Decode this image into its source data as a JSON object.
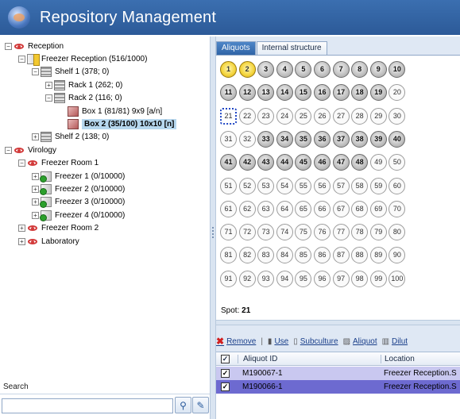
{
  "window": {
    "title": "Repository Management"
  },
  "tree": [
    {
      "label": "Reception",
      "level": 0,
      "icon": "eye-icon",
      "expander": "−"
    },
    {
      "label": "Freezer Reception (516/1000)",
      "level": 1,
      "icon": "freezer-yellow-icon",
      "expander": "−"
    },
    {
      "label": "Shelf 1 (378; 0)",
      "level": 2,
      "icon": "shelf-icon",
      "expander": "−"
    },
    {
      "label": "Rack 1 (262; 0)",
      "level": 3,
      "icon": "rack-icon",
      "expander": "+"
    },
    {
      "label": "Rack 2 (116; 0)",
      "level": 3,
      "icon": "rack-icon",
      "expander": "−"
    },
    {
      "label": "Box 1 (81/81) 9x9 [a/n]",
      "level": 4,
      "icon": "box-icon",
      "expander": ""
    },
    {
      "label": "Box 2 (35/100) 10x10 [n]",
      "level": 4,
      "icon": "box-icon",
      "expander": "",
      "selected": true
    },
    {
      "label": "Shelf 2 (138; 0)",
      "level": 2,
      "icon": "shelf-icon",
      "expander": "+"
    },
    {
      "label": "Virology",
      "level": 0,
      "icon": "eye-icon",
      "expander": "−"
    },
    {
      "label": "Freezer Room 1",
      "level": 1,
      "icon": "eye-icon",
      "expander": "−"
    },
    {
      "label": "Freezer 1 (0/10000)",
      "level": 2,
      "icon": "freezer-green-icon",
      "expander": "+"
    },
    {
      "label": "Freezer 2 (0/10000)",
      "level": 2,
      "icon": "freezer-green-icon",
      "expander": "+"
    },
    {
      "label": "Freezer 3 (0/10000)",
      "level": 2,
      "icon": "freezer-green-icon",
      "expander": "+"
    },
    {
      "label": "Freezer 4 (0/10000)",
      "level": 2,
      "icon": "freezer-green-icon",
      "expander": "+"
    },
    {
      "label": "Freezer Room 2",
      "level": 1,
      "icon": "eye-icon",
      "expander": "+"
    },
    {
      "label": "Laboratory",
      "level": 1,
      "icon": "eye-icon",
      "expander": "+"
    }
  ],
  "search": {
    "label": "Search",
    "value": ""
  },
  "tabs": [
    {
      "label": "Aliquots",
      "active": true
    },
    {
      "label": "Internal structure",
      "active": false
    }
  ],
  "grid": {
    "rows": 10,
    "cols": 10,
    "star_wells": [
      1,
      2
    ],
    "filled_wells": [
      3,
      4,
      5,
      6,
      7,
      8,
      9,
      10,
      11,
      12,
      13,
      14,
      15,
      16,
      17,
      18,
      19,
      33,
      34,
      35,
      36,
      37,
      38,
      39,
      40,
      41,
      42,
      43,
      44,
      45,
      46,
      47,
      48
    ],
    "current_well": 21
  },
  "spot": {
    "label": "Spot:",
    "value": "21"
  },
  "toolbar": [
    {
      "label": "Remove",
      "icon": "remove-x-icon",
      "name": "remove-button"
    },
    {
      "label": "Use",
      "icon": "use-icon",
      "name": "use-button"
    },
    {
      "label": "Subculture",
      "icon": "subculture-icon",
      "name": "subculture-button"
    },
    {
      "label": "Aliquot",
      "icon": "aliquot-icon",
      "name": "aliquot-button"
    },
    {
      "label": "Dilut",
      "icon": "dilution-icon",
      "name": "dilution-button"
    }
  ],
  "table": {
    "columns": [
      "Aliquot ID",
      "Location"
    ],
    "rows": [
      {
        "checked": true,
        "aliquot_id": "M190067-1",
        "location": "Freezer Reception.S"
      },
      {
        "checked": true,
        "aliquot_id": "M190066-1",
        "location": "Freezer Reception.S"
      }
    ]
  }
}
